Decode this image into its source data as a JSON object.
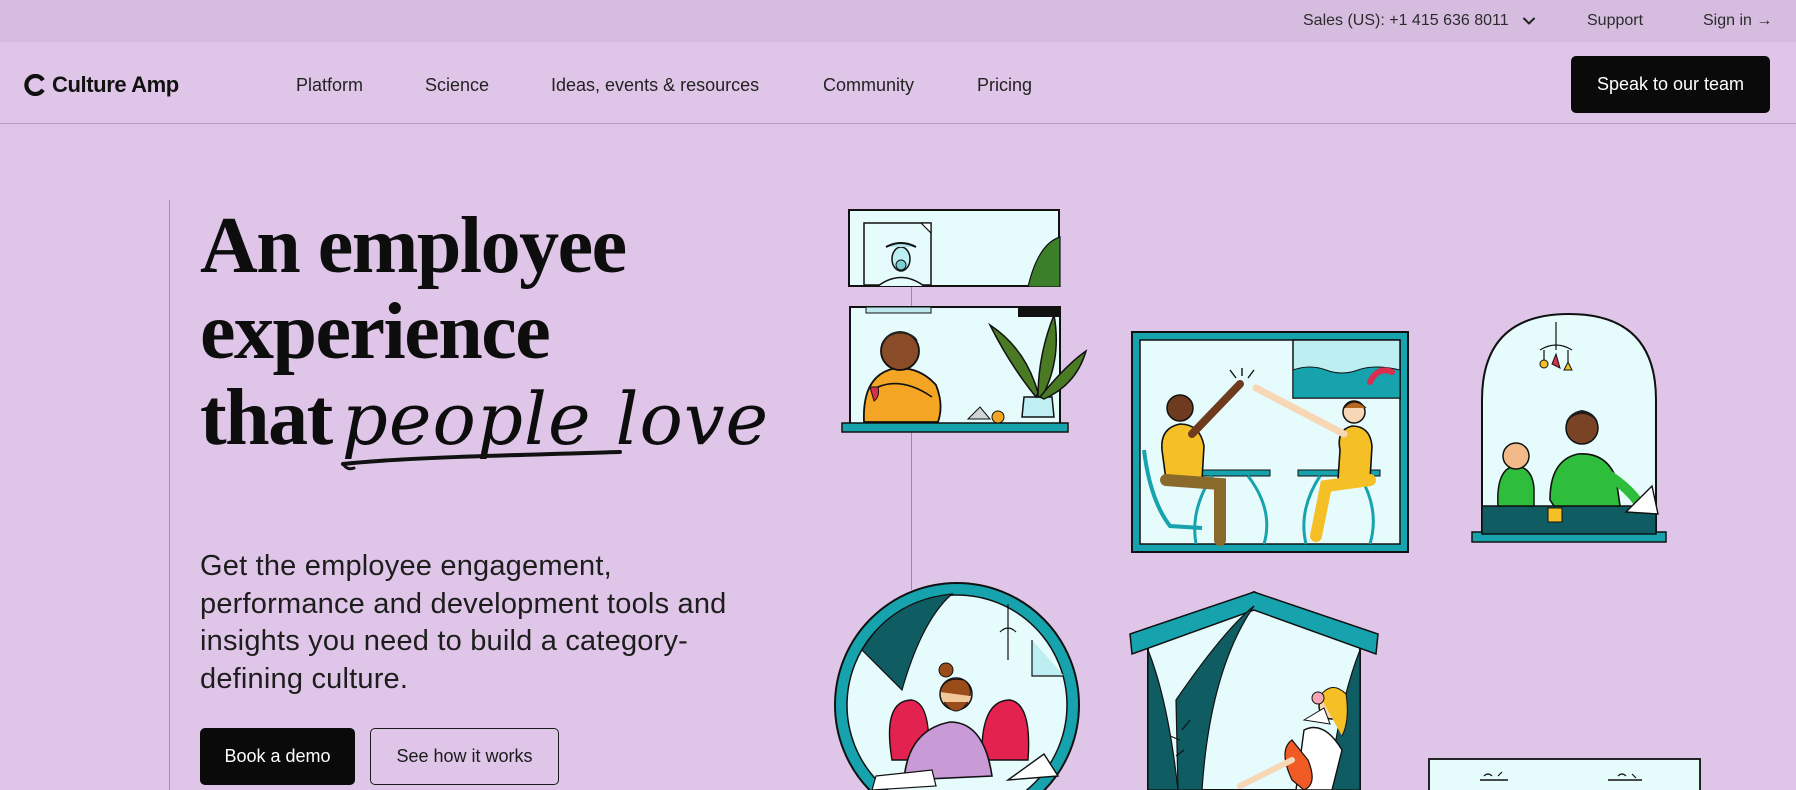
{
  "utility": {
    "sales": "Sales (US): +1 415 636 8011",
    "support": "Support",
    "signin": "Sign in →"
  },
  "nav": {
    "brand": "Culture Amp",
    "links": [
      "Platform",
      "Science",
      "Ideas, events & resources",
      "Community",
      "Pricing"
    ],
    "cta": "Speak to our team"
  },
  "hero": {
    "title_line1": "An employee",
    "title_line2": "experience",
    "title_line3": "that",
    "title_script": "people love",
    "subtitle": "Get the employee engagement, performance and development tools and insights you need to build a category-defining culture.",
    "primary_button": "Book a demo",
    "secondary_button": "See how it works"
  },
  "colors": {
    "background": "#dfc6e8",
    "utility_bar": "#d6bde0",
    "button": "#0a0a0a",
    "teal": "#17a3ad",
    "pale_cyan": "#e6fbfc"
  },
  "icons": {
    "sales_dropdown": "chevron-down-icon",
    "logo": "culture-amp-logo"
  }
}
